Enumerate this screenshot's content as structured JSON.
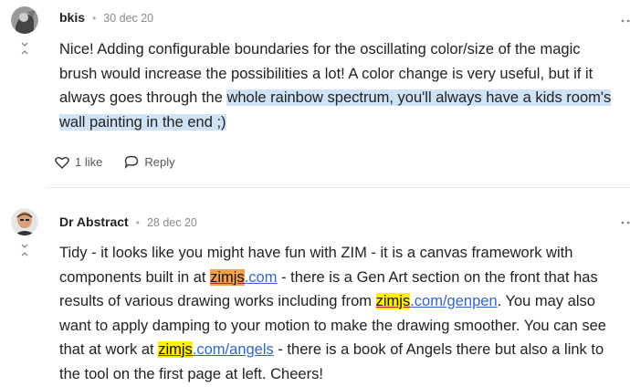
{
  "posts": [
    {
      "username": "bkis",
      "date": "30 dec 20",
      "body": {
        "text_plain": "Nice! Adding configurable boundaries for the oscillating color/size of the magic brush would increase the possibilities a lot! A color change is very useful, but if it always goes through the ",
        "text_selected": "whole rainbow spectrum, you'll always have a kids room's wall painting in the end ;)"
      },
      "actions": {
        "like_label": "1 like",
        "reply_label": "Reply"
      }
    },
    {
      "username": "Dr Abstract",
      "date": "28 dec 20",
      "body": {
        "seg1": "Tidy - it looks like you might have fun with ZIM - it is a canvas framework with components built in at ",
        "link1_hl": "zimjs",
        "link1_rest": ".com",
        "seg2": " - there is a Gen Art section on the front that has results of various drawing works including from ",
        "link2_hl": "zimjs",
        "link2_rest": ".com/genpen",
        "seg3": ". You may also want to apply damping to your motion to make the drawing smoother. You can see that at work at ",
        "link3_hl": "zimjs",
        "link3_rest": ".com/angels",
        "seg4": " - there is a book of Angels there but also a link to the tool on the first page at left. Cheers!"
      }
    }
  ],
  "icons": {
    "expand": "expand-vertical-icon",
    "menu": "more-dots-icon",
    "like": "heart-icon",
    "reply": "speech-bubble-icon"
  },
  "colors": {
    "selection": "#cfe2f6",
    "highlight_orange": "#f5a04a",
    "highlight_yellow": "#fff200",
    "link": "#3366cc"
  }
}
